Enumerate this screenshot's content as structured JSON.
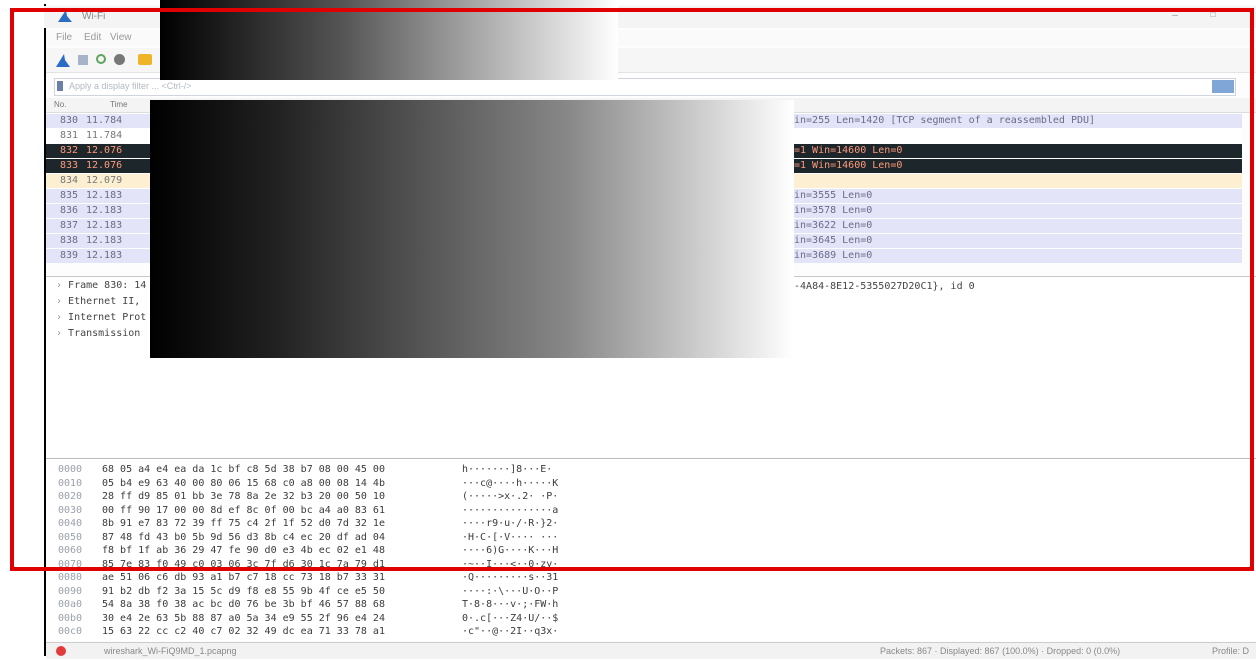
{
  "window": {
    "title": "Wi-Fi",
    "controls": {
      "minimize": "—",
      "maximize": "☐"
    }
  },
  "menu": [
    "File",
    "Edit",
    "View"
  ],
  "filter": {
    "placeholder": "Apply a display filter ... <Ctrl-/>"
  },
  "columns": {
    "no": "No.",
    "time": "Time"
  },
  "packets": [
    {
      "no": "830",
      "time": "11.784",
      "info": "in=255 Len=1420 [TCP segment of a reassembled PDU]",
      "style": "tcp"
    },
    {
      "no": "831",
      "time": "11.784",
      "info": "",
      "style": "plain"
    },
    {
      "no": "832",
      "time": "12.076",
      "info": "=1 Win=14600 Len=0",
      "style": "dark"
    },
    {
      "no": "833",
      "time": "12.076",
      "info": "=1 Win=14600 Len=0",
      "style": "dark"
    },
    {
      "no": "834",
      "time": "12.079",
      "info": "",
      "style": "selected"
    },
    {
      "no": "835",
      "time": "12.183",
      "info": "in=3555 Len=0",
      "style": "tcp"
    },
    {
      "no": "836",
      "time": "12.183",
      "info": "in=3578 Len=0",
      "style": "tcp"
    },
    {
      "no": "837",
      "time": "12.183",
      "info": "in=3622 Len=0",
      "style": "tcp"
    },
    {
      "no": "838",
      "time": "12.183",
      "info": "in=3645 Len=0",
      "style": "tcp"
    },
    {
      "no": "839",
      "time": "12.183",
      "info": "in=3689 Len=0",
      "style": "tcp"
    }
  ],
  "details": [
    "Frame 830: 14",
    "Ethernet II,",
    "Internet Prot",
    "Transmission"
  ],
  "detail_tail": "3-4A84-8E12-5355027D20C1}, id 0",
  "bytes": [
    {
      "off": "0000",
      "hex": "68 05 a4 e4 ea da 1c bf  c8 5d 38 b7 08 00 45 00",
      "ascii": "h·······]8···E·"
    },
    {
      "off": "0010",
      "hex": "05 b4 e9 63 40 00 80 06  15 68 c0 a8 00 08 14 4b",
      "ascii": "···c@····h·····K"
    },
    {
      "off": "0020",
      "hex": "28 ff d9 85 01 bb 3e 78  8a 2e 32 b3 20 00 50 10",
      "ascii": "(·····>x·.2· ·P·"
    },
    {
      "off": "0030",
      "hex": "00 ff 90 17 00 00 8d ef  8c 0f 00 bc a4 a0 83 61",
      "ascii": "···············a"
    },
    {
      "off": "0040",
      "hex": "8b 91 e7 83 72 39 ff 75  c4 2f 1f 52 d0 7d 32 1e",
      "ascii": "····r9·u·/·R·}2·"
    },
    {
      "off": "0050",
      "hex": "87 48 fd 43 b0 5b 9d 56  d3 8b c4 ec 20 df ad 04",
      "ascii": "·H·C·[·V···· ···"
    },
    {
      "off": "0060",
      "hex": "f8 bf 1f ab 36 29 47 fe  90 d0 e3 4b ec 02 e1 48",
      "ascii": "····6)G····K···H"
    },
    {
      "off": "0070",
      "hex": "85 7e 83 f0 49 c0 03 06  3c 7f d6 30 1c 7a 79 d1",
      "ascii": "·~··I···<··0·zy·"
    },
    {
      "off": "0080",
      "hex": "ae 51 06 c6 db 93 a1 b7  c7 18 cc 73 18 b7 33 31",
      "ascii": "·Q·········s··31"
    },
    {
      "off": "0090",
      "hex": "91 b2 db f2 3a 15 5c d9  f8 e8 55 9b 4f ce e5 50",
      "ascii": "····:·\\···U·O··P"
    },
    {
      "off": "00a0",
      "hex": "54 8a 38 f0 38 ac bc d0  76 be 3b bf 46 57 88 68",
      "ascii": "T·8·8···v·;·FW·h"
    },
    {
      "off": "00b0",
      "hex": "30 e4 2e 63 5b 88 87 a0  5a 34 e9 55 2f 96 e4 24",
      "ascii": "0·.c[···Z4·U/··$"
    },
    {
      "off": "00c0",
      "hex": "15 63 22 cc c2 40 c7 02  32 49 dc ea 71 33 78 a1",
      "ascii": "·c\"··@··2I··q3x·"
    }
  ],
  "status": {
    "left": "wireshark_Wi-FiQ9MD_1.pcapng",
    "center": "Packets: 867 · Displayed: 867 (100.0%) · Dropped: 0 (0.0%)",
    "right": "Profile: D"
  },
  "colors": {
    "tcp_row": "#e4e4f8",
    "dark_row": "#1c262b",
    "selected_row": "#fdf0d2",
    "highlight": "#e00000",
    "shark_fin": "#2b6cc4"
  }
}
